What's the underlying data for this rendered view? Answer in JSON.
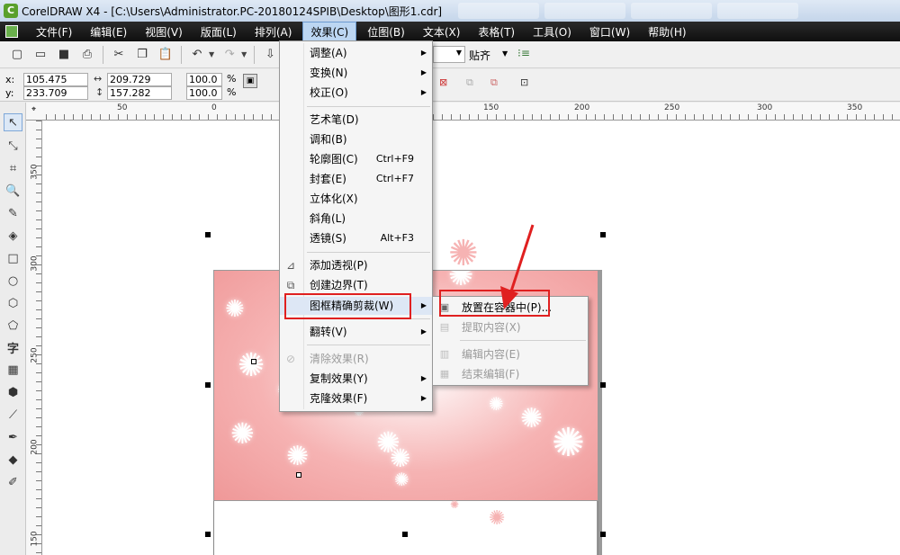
{
  "window": {
    "title": "CorelDRAW X4 - [C:\\Users\\Administrator.PC-20180124SPIB\\Desktop\\图形1.cdr]",
    "app_icon": "corel-balloon-icon"
  },
  "menubar": {
    "items": [
      "文件(F)",
      "编辑(E)",
      "视图(V)",
      "版面(L)",
      "排列(A)",
      "效果(C)",
      "位图(B)",
      "文本(X)",
      "表格(T)",
      "工具(O)",
      "窗口(W)",
      "帮助(H)"
    ],
    "active": "效果(C)"
  },
  "toolbar": {
    "snap_label": "贴齐"
  },
  "property_bar": {
    "x_label": "x:",
    "x_value": "105.475 mm",
    "y_label": "y:",
    "y_value": "233.709 mm",
    "width_value": "209.729 mm",
    "height_value": "157.282 mm",
    "scale_x": "100.0",
    "scale_y": "100.0",
    "percent": "%"
  },
  "ruler": {
    "top_ticks": [
      "50",
      "0",
      "50",
      "100",
      "150",
      "200",
      "250",
      "300",
      "350"
    ],
    "left_ticks": [
      "350",
      "300",
      "250",
      "200",
      "150"
    ]
  },
  "effects_menu": {
    "items": [
      {
        "label": "调整(A)",
        "shortcut": "",
        "submenu": true,
        "disabled": false,
        "icon": ""
      },
      {
        "label": "变换(N)",
        "shortcut": "",
        "submenu": true,
        "disabled": false,
        "icon": ""
      },
      {
        "label": "校正(O)",
        "shortcut": "",
        "submenu": true,
        "disabled": false,
        "icon": ""
      },
      {
        "label": "艺术笔(D)",
        "shortcut": "",
        "submenu": false,
        "disabled": false,
        "icon": ""
      },
      {
        "label": "调和(B)",
        "shortcut": "",
        "submenu": false,
        "disabled": false,
        "icon": ""
      },
      {
        "label": "轮廓图(C)",
        "shortcut": "Ctrl+F9",
        "submenu": false,
        "disabled": false,
        "icon": ""
      },
      {
        "label": "封套(E)",
        "shortcut": "Ctrl+F7",
        "submenu": false,
        "disabled": false,
        "icon": ""
      },
      {
        "label": "立体化(X)",
        "shortcut": "",
        "submenu": false,
        "disabled": false,
        "icon": ""
      },
      {
        "label": "斜角(L)",
        "shortcut": "",
        "submenu": false,
        "disabled": false,
        "icon": ""
      },
      {
        "label": "透镜(S)",
        "shortcut": "Alt+F3",
        "submenu": false,
        "disabled": false,
        "icon": ""
      },
      {
        "label": "添加透视(P)",
        "shortcut": "",
        "submenu": false,
        "disabled": false,
        "icon": "perspective-icon"
      },
      {
        "label": "创建边界(T)",
        "shortcut": "",
        "submenu": false,
        "disabled": false,
        "icon": "boundary-icon"
      },
      {
        "label": "图框精确剪裁(W)",
        "shortcut": "",
        "submenu": true,
        "disabled": false,
        "icon": ""
      },
      {
        "label": "翻转(V)",
        "shortcut": "",
        "submenu": true,
        "disabled": false,
        "icon": ""
      },
      {
        "label": "清除效果(R)",
        "shortcut": "",
        "submenu": false,
        "disabled": true,
        "icon": "clear-effect-icon"
      },
      {
        "label": "复制效果(Y)",
        "shortcut": "",
        "submenu": true,
        "disabled": false,
        "icon": ""
      },
      {
        "label": "克隆效果(F)",
        "shortcut": "",
        "submenu": true,
        "disabled": false,
        "icon": ""
      }
    ]
  },
  "powerclip_submenu": {
    "items": [
      {
        "label": "放置在容器中(P)...",
        "disabled": false,
        "icon": "place-in-container-icon"
      },
      {
        "label": "提取内容(X)",
        "disabled": true,
        "icon": "extract-contents-icon"
      },
      {
        "label": "编辑内容(E)",
        "disabled": true,
        "icon": "edit-contents-icon"
      },
      {
        "label": "结束编辑(F)",
        "disabled": true,
        "icon": "finish-editing-icon"
      }
    ]
  },
  "colors": {
    "highlight_box": "#e02020",
    "menubar_bg": "#1a1a1a",
    "pink_edge": "#ef9898"
  }
}
